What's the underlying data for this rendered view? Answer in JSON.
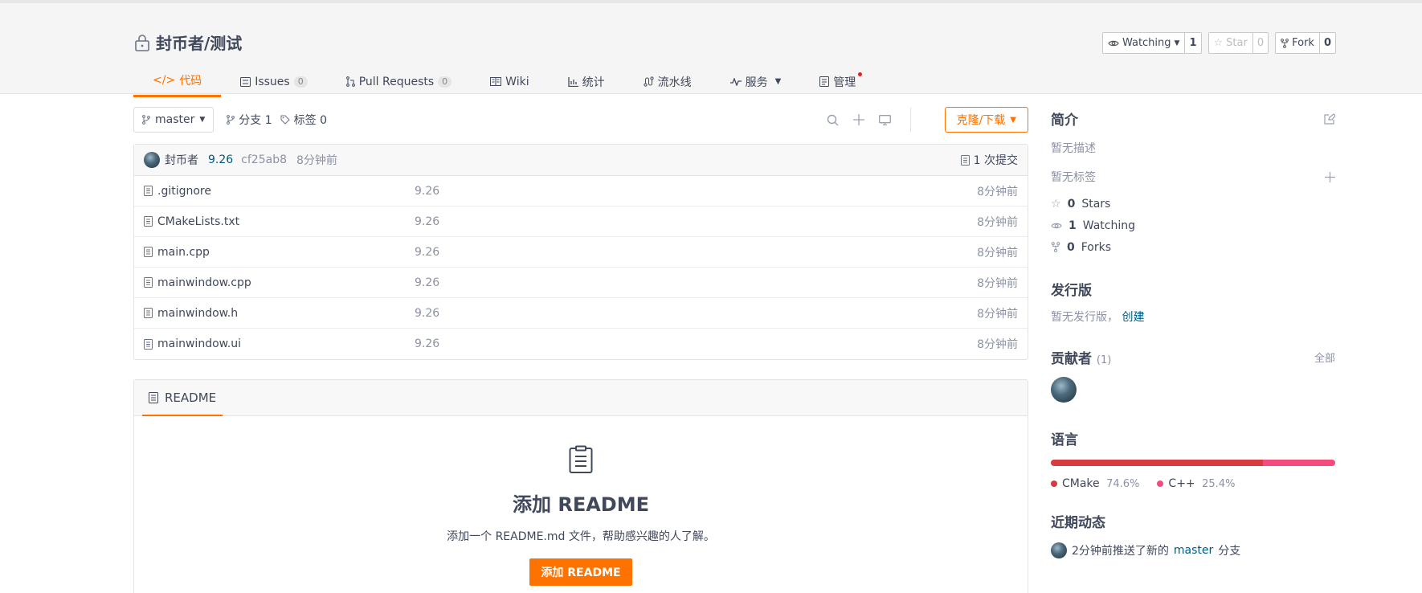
{
  "repo": {
    "title": "封币者/测试"
  },
  "header_buttons": [
    {
      "label": "Watching",
      "count": "1"
    },
    {
      "label": "Star",
      "count": "0"
    },
    {
      "label": "Fork",
      "count": "0"
    }
  ],
  "tabs": [
    {
      "label": "代码",
      "badge": ""
    },
    {
      "label": "Issues",
      "badge": "0"
    },
    {
      "label": "Pull Requests",
      "badge": "0"
    },
    {
      "label": "Wiki",
      "badge": ""
    },
    {
      "label": "统计",
      "badge": ""
    },
    {
      "label": "流水线",
      "badge": ""
    },
    {
      "label": "服务",
      "badge": ""
    },
    {
      "label": "管理",
      "badge": ""
    }
  ],
  "toolbar": {
    "branch": "master",
    "branches": "分支 1",
    "tags": "标签 0",
    "clone": "克隆/下载"
  },
  "commit": {
    "author": "封币者",
    "message": "9.26",
    "sha": "cf25ab8",
    "time": "8分钟前",
    "count": "1 次提交"
  },
  "files": [
    {
      "name": ".gitignore",
      "message": "9.26",
      "time": "8分钟前"
    },
    {
      "name": "CMakeLists.txt",
      "message": "9.26",
      "time": "8分钟前"
    },
    {
      "name": "main.cpp",
      "message": "9.26",
      "time": "8分钟前"
    },
    {
      "name": "mainwindow.cpp",
      "message": "9.26",
      "time": "8分钟前"
    },
    {
      "name": "mainwindow.h",
      "message": "9.26",
      "time": "8分钟前"
    },
    {
      "name": "mainwindow.ui",
      "message": "9.26",
      "time": "8分钟前"
    }
  ],
  "readme": {
    "tab": "README",
    "title": "添加 README",
    "desc": "添加一个 README.md 文件，帮助感兴趣的人了解。",
    "button": "添加 README"
  },
  "sidebar": {
    "intro_title": "简介",
    "no_desc": "暂无描述",
    "no_tags": "暂无标签",
    "stars_count": "0",
    "stars_label": "Stars",
    "watching_count": "1",
    "watching_label": "Watching",
    "forks_count": "0",
    "forks_label": "Forks",
    "release_title": "发行版",
    "no_release": "暂无发行版，",
    "create": "创建",
    "contrib_title": "贡献者",
    "contrib_count": "(1)",
    "all": "全部",
    "lang_title": "语言",
    "languages": [
      {
        "name": "CMake",
        "percent": "74.6%",
        "value": 74.6,
        "color": "#d73a3f"
      },
      {
        "name": "C++",
        "percent": "25.4%",
        "value": 25.4,
        "color": "#f34b7d"
      }
    ],
    "activity_title": "近期动态",
    "activity_prefix": "2分钟前推送了新的",
    "activity_branch": "master",
    "activity_suffix": "分支"
  },
  "colors": {
    "accent": "#fe7300",
    "link": "#005980",
    "muted": "#8c92a4"
  }
}
